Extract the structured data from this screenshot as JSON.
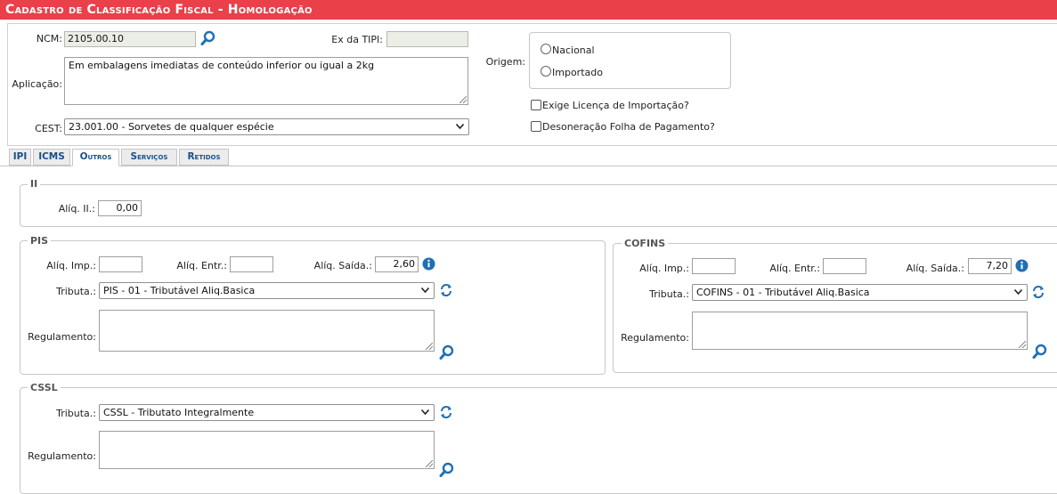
{
  "window": {
    "title": "Cadastro de Classificação Fiscal  - Homologação"
  },
  "header": {
    "ncm_label": "NCM:",
    "ncm_value": "2105.00.10",
    "ex_tipi_label": "Ex da TIPI:",
    "ex_tipi_value": "",
    "aplicacao_label": "Aplicação:",
    "aplicacao_value": "Em embalagens imediatas de conteúdo inferior ou igual a 2kg",
    "cest_label": "CEST:",
    "cest_value": "23.001.00 - Sorvetes de qualquer espécie",
    "origem_label": "Origem:",
    "origem_options": [
      "Nacional",
      "Importado"
    ],
    "exige_licenca_label": "Exige Licença de Importação?",
    "desoneracao_label": "Desoneração Folha de Pagamento?"
  },
  "tabs": [
    {
      "label": "IPI"
    },
    {
      "label": "ICMS"
    },
    {
      "label": "Outros"
    },
    {
      "label": "Serviços"
    },
    {
      "label": "Retidos"
    }
  ],
  "active_tab": "Outros",
  "ii": {
    "legend": "II",
    "aliq_label": "Alíq. II.:",
    "aliq_value": "0,00"
  },
  "pis": {
    "legend": "PIS",
    "aliq_imp_label": "Alíq. Imp.:",
    "aliq_imp_value": "",
    "aliq_entr_label": "Alíq. Entr.:",
    "aliq_entr_value": "",
    "aliq_saida_label": "Alíq. Saída.:",
    "aliq_saida_value": "2,60",
    "tributa_label": "Tributa.:",
    "tributa_value": "PIS - 01 - Tributável Aliq.Basica",
    "regulamento_label": "Regulamento:",
    "regulamento_value": ""
  },
  "cofins": {
    "legend": "COFINS",
    "aliq_imp_label": "Alíq. Imp.:",
    "aliq_imp_value": "",
    "aliq_entr_label": "Alíq. Entr.:",
    "aliq_entr_value": "",
    "aliq_saida_label": "Alíq. Saída.:",
    "aliq_saida_value": "7,20",
    "tributa_label": "Tributa.:",
    "tributa_value": "COFINS - 01 - Tributável Aliq.Basica",
    "regulamento_label": "Regulamento:",
    "regulamento_value": ""
  },
  "cssl": {
    "legend": "CSSL",
    "tributa_label": "Tributa.:",
    "tributa_value": "CSSL - Tributato Integralmente",
    "regulamento_label": "Regulamento:",
    "regulamento_value": ""
  },
  "icons": {
    "search": "magnifier-icon",
    "info": "info-icon",
    "refresh": "refresh-icon",
    "chevron": "chevron-down-icon"
  },
  "colors": {
    "title_bar": "#e9404a",
    "accent_blue": "#1f6fb5",
    "readonly_bg": "#ebeee4"
  }
}
